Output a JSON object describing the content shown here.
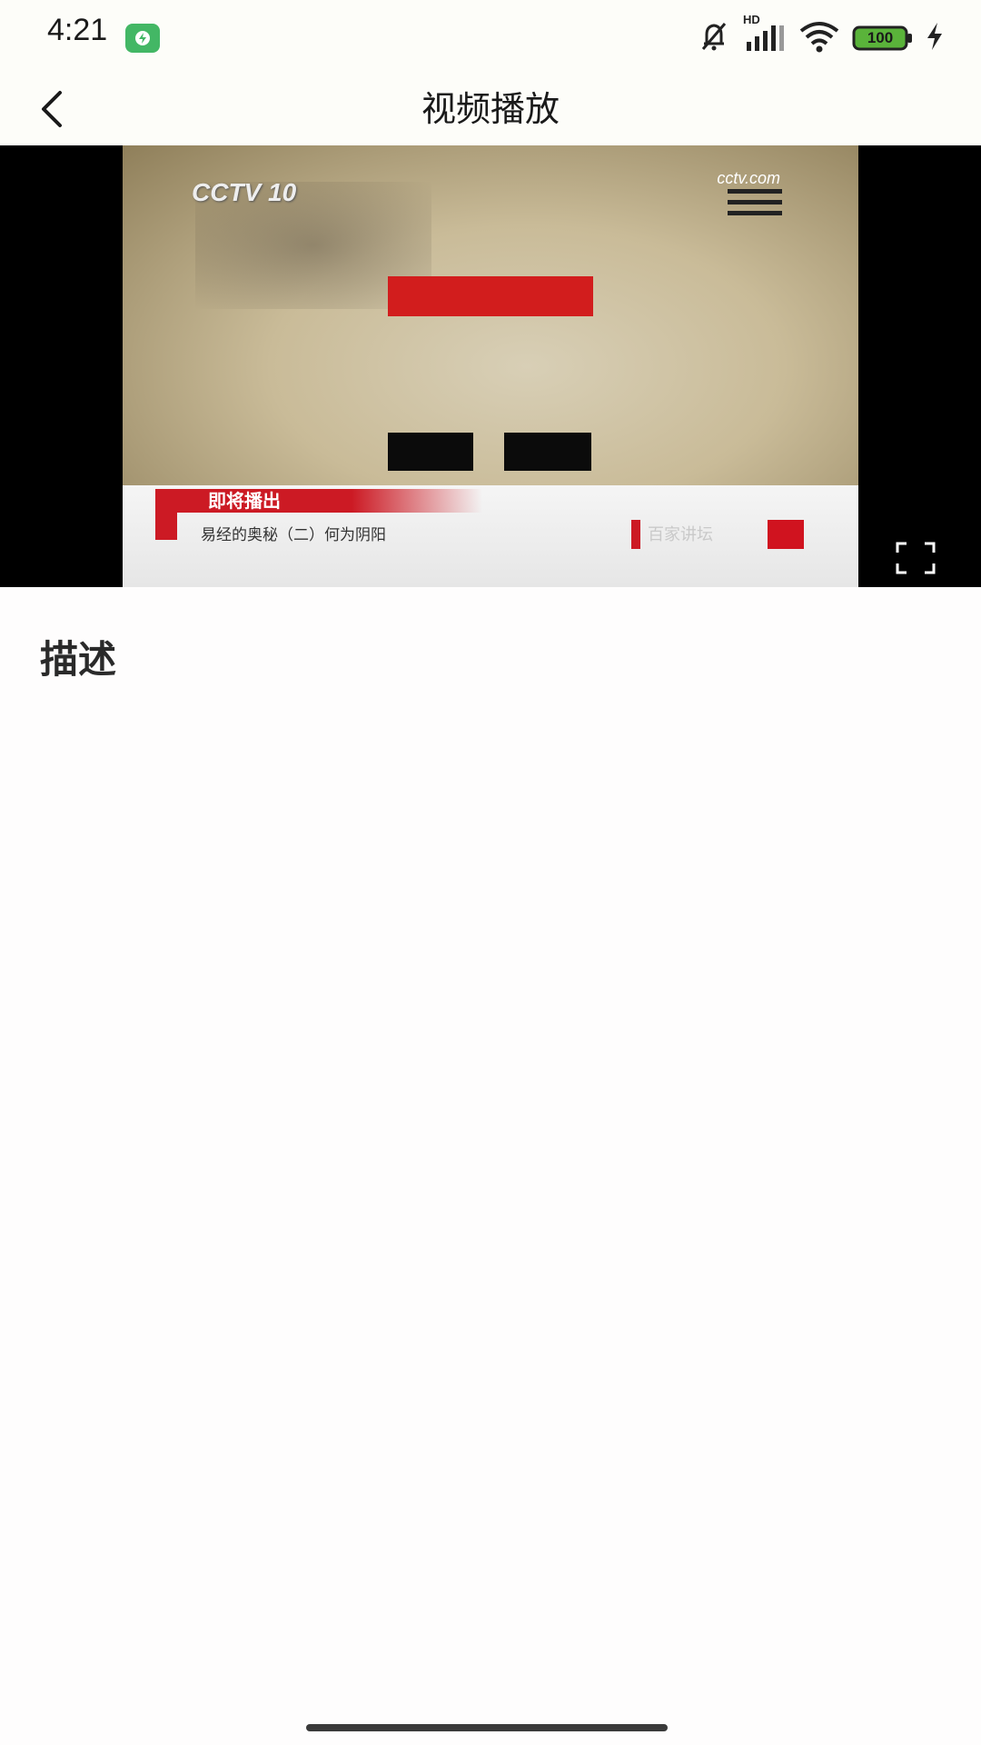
{
  "status_bar": {
    "time": "4:21",
    "battery": "100",
    "network": "HD"
  },
  "app_bar": {
    "title": "视频播放"
  },
  "video": {
    "channel_logo": "CCTV 10",
    "site_logo": "cctv.com",
    "lower_third_heading": "即将播出",
    "lower_third_subtitle": "易经的奥秘（二）何为阴阳",
    "brand_text": "百家讲坛"
  },
  "content": {
    "description_label": "描述"
  },
  "icons": {
    "back": "chevron-left-icon",
    "fullscreen": "fullscreen-icon",
    "mute": "bell-off-icon",
    "signal": "signal-icon",
    "wifi": "wifi-icon",
    "battery": "battery-icon",
    "charging": "lightning-icon",
    "shield": "shield-icon"
  },
  "colors": {
    "battery_fill": "#5ab33a",
    "brand_red": "#cc1a24",
    "shield_green": "#43b765"
  }
}
